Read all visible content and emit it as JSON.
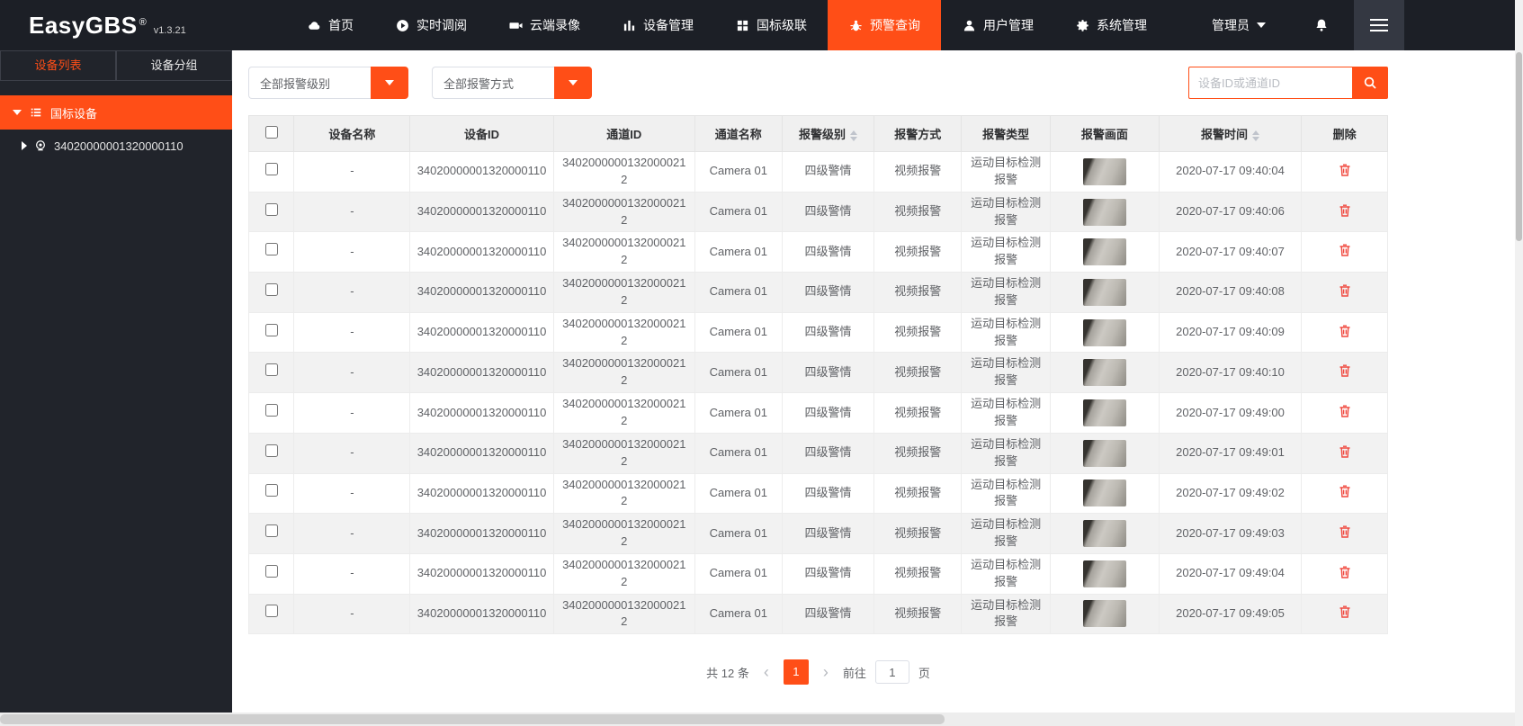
{
  "app": {
    "name": "EasyGBS",
    "reg": "®",
    "version": "v1.3.21"
  },
  "navbar": {
    "items": [
      {
        "label": "首页",
        "icon": "home-icon"
      },
      {
        "label": "实时调阅",
        "icon": "play-icon"
      },
      {
        "label": "云端录像",
        "icon": "video-camera-icon"
      },
      {
        "label": "设备管理",
        "icon": "device-bars-icon"
      },
      {
        "label": "国标级联",
        "icon": "cascade-grid-icon"
      },
      {
        "label": "预警查询",
        "icon": "alarm-bug-icon"
      },
      {
        "label": "用户管理",
        "icon": "user-icon"
      },
      {
        "label": "系统管理",
        "icon": "gear-icon"
      }
    ],
    "active_label": "预警查询",
    "admin": "管理员"
  },
  "sidebar": {
    "tabs": [
      {
        "label": "设备列表"
      },
      {
        "label": "设备分组"
      }
    ],
    "active_tab": "设备列表",
    "tree_root": "国标设备",
    "device_id": "34020000001320000110"
  },
  "filters": {
    "level": "全部报警级别",
    "method": "全部报警方式",
    "search_placeholder": "设备ID或通道ID"
  },
  "table": {
    "headers": [
      "设备名称",
      "设备ID",
      "通道ID",
      "通道名称",
      "报警级别",
      "报警方式",
      "报警类型",
      "报警画面",
      "报警时间",
      "删除"
    ],
    "rows": [
      {
        "device_name": "-",
        "device_id": "34020000001320000110",
        "channel_id": "34020000001320000212",
        "channel_name": "Camera 01",
        "level": "四级警情",
        "method": "视频报警",
        "type": "运动目标检测报警",
        "time": "2020-07-17 09:40:04"
      },
      {
        "device_name": "-",
        "device_id": "34020000001320000110",
        "channel_id": "34020000001320000212",
        "channel_name": "Camera 01",
        "level": "四级警情",
        "method": "视频报警",
        "type": "运动目标检测报警",
        "time": "2020-07-17 09:40:06"
      },
      {
        "device_name": "-",
        "device_id": "34020000001320000110",
        "channel_id": "34020000001320000212",
        "channel_name": "Camera 01",
        "level": "四级警情",
        "method": "视频报警",
        "type": "运动目标检测报警",
        "time": "2020-07-17 09:40:07"
      },
      {
        "device_name": "-",
        "device_id": "34020000001320000110",
        "channel_id": "34020000001320000212",
        "channel_name": "Camera 01",
        "level": "四级警情",
        "method": "视频报警",
        "type": "运动目标检测报警",
        "time": "2020-07-17 09:40:08"
      },
      {
        "device_name": "-",
        "device_id": "34020000001320000110",
        "channel_id": "34020000001320000212",
        "channel_name": "Camera 01",
        "level": "四级警情",
        "method": "视频报警",
        "type": "运动目标检测报警",
        "time": "2020-07-17 09:40:09"
      },
      {
        "device_name": "-",
        "device_id": "34020000001320000110",
        "channel_id": "34020000001320000212",
        "channel_name": "Camera 01",
        "level": "四级警情",
        "method": "视频报警",
        "type": "运动目标检测报警",
        "time": "2020-07-17 09:40:10"
      },
      {
        "device_name": "-",
        "device_id": "34020000001320000110",
        "channel_id": "34020000001320000212",
        "channel_name": "Camera 01",
        "level": "四级警情",
        "method": "视频报警",
        "type": "运动目标检测报警",
        "time": "2020-07-17 09:49:00"
      },
      {
        "device_name": "-",
        "device_id": "34020000001320000110",
        "channel_id": "34020000001320000212",
        "channel_name": "Camera 01",
        "level": "四级警情",
        "method": "视频报警",
        "type": "运动目标检测报警",
        "time": "2020-07-17 09:49:01"
      },
      {
        "device_name": "-",
        "device_id": "34020000001320000110",
        "channel_id": "34020000001320000212",
        "channel_name": "Camera 01",
        "level": "四级警情",
        "method": "视频报警",
        "type": "运动目标检测报警",
        "time": "2020-07-17 09:49:02"
      },
      {
        "device_name": "-",
        "device_id": "34020000001320000110",
        "channel_id": "34020000001320000212",
        "channel_name": "Camera 01",
        "level": "四级警情",
        "method": "视频报警",
        "type": "运动目标检测报警",
        "time": "2020-07-17 09:49:03"
      },
      {
        "device_name": "-",
        "device_id": "34020000001320000110",
        "channel_id": "34020000001320000212",
        "channel_name": "Camera 01",
        "level": "四级警情",
        "method": "视频报警",
        "type": "运动目标检测报警",
        "time": "2020-07-17 09:49:04"
      },
      {
        "device_name": "-",
        "device_id": "34020000001320000110",
        "channel_id": "34020000001320000212",
        "channel_name": "Camera 01",
        "level": "四级警情",
        "method": "视频报警",
        "type": "运动目标检测报警",
        "time": "2020-07-17 09:49:05"
      }
    ]
  },
  "pagination": {
    "total": "共 12 条",
    "prev_icon": "‹",
    "next_icon": "›",
    "page": "1",
    "goto_label": "前往",
    "goto_value": "1",
    "page_suffix": "页"
  },
  "colors": {
    "accent": "#ff4e17",
    "navbar": "#1c1f26",
    "danger": "#f0483e"
  }
}
